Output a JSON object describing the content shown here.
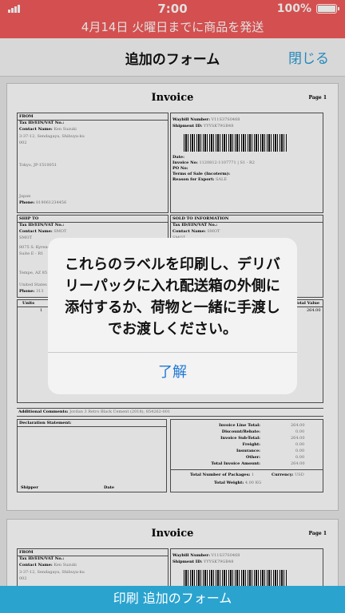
{
  "status_bar": {
    "time": "7:00",
    "battery": "100%"
  },
  "banner": {
    "text": "4月14日 火曜日までに商品を発送"
  },
  "navbar": {
    "title": "追加のフォーム",
    "close_label": "閉じる"
  },
  "invoice": {
    "title": "Invoice",
    "page": "Page 1",
    "from_header": "FROM",
    "from_tax": "Tax ID/EIN/VAT No.:",
    "from_contact_label": "Contact Name:",
    "from_contact_value": "Ken Suzuki",
    "from_address_1": "3-37-12, Sendagaya, Shibuya-ku",
    "from_address_2": "002",
    "from_city": "Tokyo, JP-1510051",
    "from_country": "Japan",
    "from_phone_label": "Phone:",
    "from_phone_value": "819061234456",
    "waybill_label": "Waybill Number:",
    "waybill_value": "V11S37S0468",
    "shipment_label": "Shipment ID:",
    "shipment_value": "YYYSK79GB48",
    "date_label": "Date:",
    "invoice_no_label": "Invoice No:",
    "invoice_no_value": "1120812-1107771 | S1 - R2",
    "po_label": "PO No:",
    "terms_label": "Terms of Sale (Incoterm):",
    "reason_label": "Reason for Export:",
    "reason_value": "SALE",
    "ship_to_header": "SHIP TO",
    "ship_tax": "Tax ID/EIN/VAT No.:",
    "ship_contact_label": "Contact Name:",
    "ship_contact_value": "SMOT",
    "ship_company": "SMOT",
    "ship_address_1": "8075 S. Kyrene",
    "ship_address_2": "Suite E - R1",
    "ship_city": "Tempe, AZ 85",
    "ship_country": "United States",
    "ship_phone_label": "Phone:",
    "ship_phone_value": "313",
    "sold_header": "SOLD TO INFORMATION",
    "sold_tax": "Tax ID/EIN/VAT No.:",
    "sold_contact_label": "Contact Name:",
    "sold_contact_value": "SMOT",
    "sold_company": "SMOT",
    "units_label": "Units",
    "units_value": "1",
    "total_value_label": "Total Value",
    "total_value_value": "264.00",
    "comments_label": "Additional Comments:",
    "comments_value": "Jordan 3 Retro Black Cement (2018), 854262-001",
    "declaration_label": "Declaration Statement:",
    "shipper_label": "Shipper",
    "date_sig_label": "Date",
    "line_total_label": "Invoice Line Total:",
    "line_total_value": "264.00",
    "discount_label": "Discount/Rebate:",
    "discount_value": "0.00",
    "subtotal_label": "Invoice Sub-Total:",
    "subtotal_value": "264.00",
    "freight_label": "Freight:",
    "freight_value": "0.00",
    "insurance_label": "Insurance:",
    "insurance_value": "0.00",
    "other_label": "Other:",
    "other_value": "0.00",
    "amount_label": "Total Invoice Amount:",
    "amount_value": "264.00",
    "packages_label": "Total Number of Packages:",
    "packages_value": "1",
    "currency_label": "Currency:",
    "currency_value": "USD",
    "weight_label": "Total Weight:",
    "weight_value": "4.00 KG"
  },
  "alert": {
    "message": "これらのラベルを印刷し、デリバリーパックに入れ配送箱の外側に添付するか、荷物と一緒に手渡しでお渡しください。",
    "ok_label": "了解"
  },
  "bottom_bar": {
    "label": "印刷 追加のフォーム"
  }
}
